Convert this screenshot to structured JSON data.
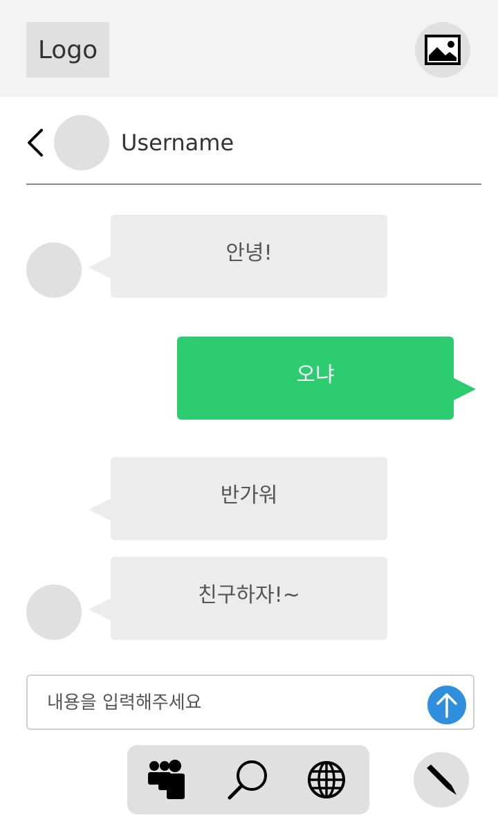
{
  "header": {
    "logo_text": "Logo",
    "image_button_icon": "image-icon"
  },
  "chat_header": {
    "back_icon": "chevron-left-icon",
    "username": "Username"
  },
  "messages": [
    {
      "direction": "incoming",
      "text": "안녕!",
      "show_avatar": true
    },
    {
      "direction": "outgoing",
      "text": "오냐",
      "show_avatar": false
    },
    {
      "direction": "incoming",
      "text": "반가워",
      "show_avatar": false
    },
    {
      "direction": "incoming",
      "text": "친구하자!~",
      "show_avatar": true
    }
  ],
  "composer": {
    "placeholder": "내용을 입력해주세요",
    "value": "",
    "send_icon": "arrow-up-icon"
  },
  "bottom_nav": {
    "items": [
      {
        "icon": "people-icon"
      },
      {
        "icon": "search-icon"
      },
      {
        "icon": "globe-icon"
      }
    ],
    "compose_icon": "pencil-icon"
  },
  "colors": {
    "outgoing_bubble": "#2ecc71",
    "incoming_bubble": "#ececec",
    "send_button": "#2f8fdc",
    "header_bg": "#f3f3f3",
    "placeholder_grey": "#e0e0e0"
  }
}
